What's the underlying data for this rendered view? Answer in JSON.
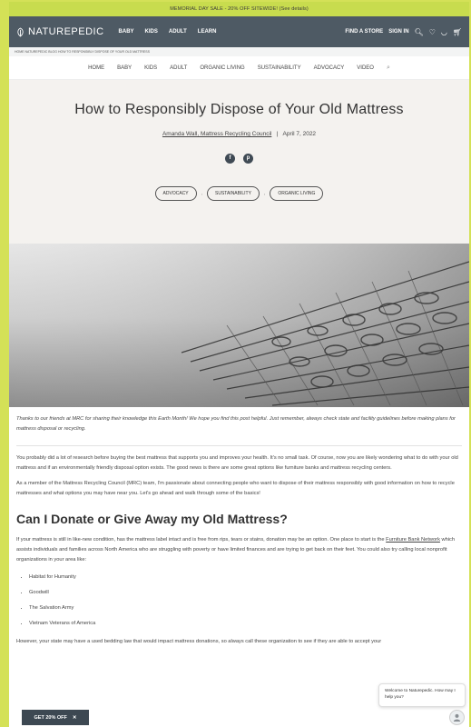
{
  "promo": {
    "text": "MEMORIAL DAY SALE - 20% OFF SITEWIDE! (See details)"
  },
  "topnav": {
    "logo": "NATUREPEDIC",
    "links": [
      "BABY",
      "KIDS",
      "ADULT",
      "LEARN"
    ],
    "find_store": "FIND A STORE",
    "sign_in": "SIGN IN"
  },
  "breadcrumb": {
    "text": "HOME   NATUREPEDIC BLOG   HOW TO RESPONSIBLY DISPOSE OF YOUR OLD MATTRESS"
  },
  "blognav": {
    "items": [
      "HOME",
      "BABY",
      "KIDS",
      "ADULT",
      "ORGANIC LIVING",
      "SUSTAINABILITY",
      "ADVOCACY",
      "VIDEO"
    ]
  },
  "article": {
    "title": "How to Responsibly Dispose of Your Old Mattress",
    "author": "Amanda Wall, Mattress Recycling Council",
    "separator": "|",
    "date": "April 7, 2022",
    "share": {
      "facebook": "f",
      "pinterest": "p"
    },
    "tags": [
      "ADVOCACY",
      "SUSTAINABILITY",
      "ORGANIC LIVING"
    ],
    "tag_separator": ",",
    "caption": "Thanks to our friends at MRC for sharing their knowledge this Earth Month! We hope you find this post helpful. Just remember, always check state and facility guidelines before making plans for mattress disposal or recycling.",
    "p1": "You probably did a lot of research before buying the best mattress that supports you and improves your health. It's no small task. Of course, now you are likely wondering what to do with your old mattress and if an environmentally friendly disposal option exists. The good news is there are some great options like furniture banks and mattress recycling centers.",
    "p2": "As a member of the Mattress Recycling Council (MRC) team, I'm passionate about connecting people who want to dispose of their mattress responsibly with good information on how to recycle mattresses and what options you may have near you. Let's go ahead and walk through some of the basics!",
    "section_heading": "Can I Donate or Give Away my Old Mattress?",
    "p3_before": "If your mattress is still in like-new condition, has the mattress label intact and is free from rips, tears or stains, donation may be an option. One place to start is the ",
    "p3_link": "Furniture Bank Network",
    "p3_after": " which assists individuals and families across North America who are struggling with poverty or have limited finances and are trying to get back on their feet. You could also try calling local nonprofit organizations in your area like:",
    "list": [
      "Habitat for Humanity",
      "Goodwill",
      "The Salvation Army",
      "Vietnam Veterans of America"
    ],
    "p4": "However, your state may have a used bedding law that would impact mattress donations, so always call these organization to see if they are able to accept your"
  },
  "widgets": {
    "promo_button": "GET 20% OFF",
    "promo_close": "✕",
    "chat_message": "Welcome to Naturepedic. How may I help you?"
  },
  "colors": {
    "accent": "#c8dc4e",
    "nav": "#4e5a64",
    "button": "#3d4852"
  },
  "icons": [
    "leaf-logo-icon",
    "search-icon",
    "heart-icon",
    "account-icon",
    "cart-icon",
    "facebook-icon",
    "pinterest-icon",
    "chat-avatar-icon"
  ]
}
